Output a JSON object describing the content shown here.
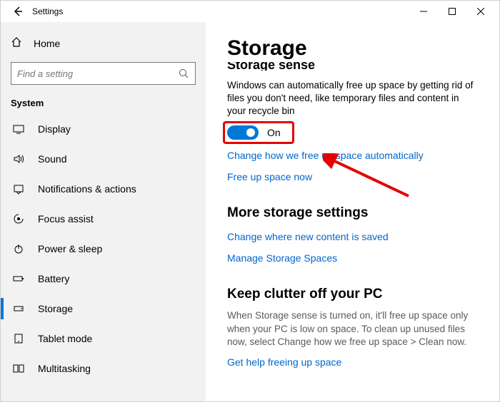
{
  "titlebar": {
    "title": "Settings"
  },
  "sidebar": {
    "home": "Home",
    "search_placeholder": "Find a setting",
    "section": "System",
    "items": [
      {
        "label": "Display"
      },
      {
        "label": "Sound"
      },
      {
        "label": "Notifications & actions"
      },
      {
        "label": "Focus assist"
      },
      {
        "label": "Power & sleep"
      },
      {
        "label": "Battery"
      },
      {
        "label": "Storage"
      },
      {
        "label": "Tablet mode"
      },
      {
        "label": "Multitasking"
      }
    ]
  },
  "content": {
    "page_title": "Storage",
    "cut_heading": "Storage sense",
    "sense_desc": "Windows can automatically free up space by getting rid of files you don't need, like temporary files and content in your recycle bin",
    "toggle_label": "On",
    "link_change": "Change how we free up space automatically",
    "link_free_now": "Free up space now",
    "more_heading": "More storage settings",
    "link_change_saved": "Change where new content is saved",
    "link_manage_spaces": "Manage Storage Spaces",
    "clutter_heading": "Keep clutter off your PC",
    "clutter_desc": "When Storage sense is turned on, it'll free up space only when your PC is low on space. To clean up unused files now, select Change how we free up space > Clean now.",
    "link_help": "Get help freeing up space"
  }
}
